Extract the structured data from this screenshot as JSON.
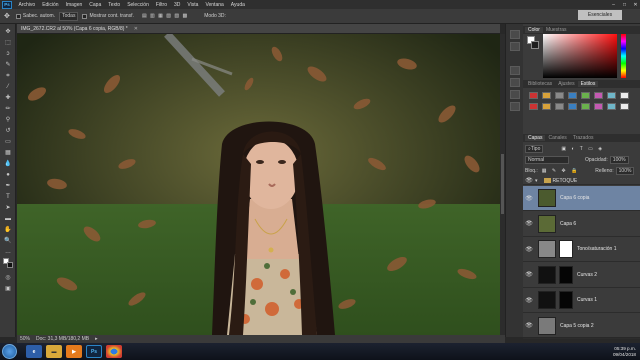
{
  "menu": {
    "items": [
      "Archivo",
      "Edición",
      "Imagen",
      "Capa",
      "Texto",
      "Selección",
      "Filtro",
      "3D",
      "Vista",
      "Ventana",
      "Ayuda"
    ]
  },
  "options": {
    "sample_label": "Todas",
    "align_label": "Sabec. autom.",
    "mode_label": "Muestrear todas las capas",
    "sample_field": "Mostrar cont. transf.",
    "mode3d": "Modo 3D:",
    "workspace": "Esenciales"
  },
  "document": {
    "tab_title": "IMG_2672.CR2 al 50% (Capa 6 copia, RGB/8) *",
    "zoom": "50%",
    "doc_info": "Doc: 31,3 MB/180,2 MB"
  },
  "panels": {
    "color_tabs": [
      "Color",
      "Muestras"
    ],
    "adjust_tabs": [
      "Bibliotecas",
      "Ajustes",
      "Estilos"
    ],
    "layers_tabs": [
      "Capas",
      "Canales",
      "Trazados"
    ],
    "kind_label": "Tipo",
    "blend_mode": "Normal",
    "opacity_label": "Opacidad:",
    "opacity_value": "100%",
    "lock_label": "Bloq.:",
    "fill_label": "Relleno:",
    "fill_value": "100%",
    "group_name": "RETOQUE",
    "layers": [
      {
        "name": "Capa 6 copia",
        "selected": true
      },
      {
        "name": "Capa 6",
        "selected": false
      },
      {
        "name": "Tono/saturación 1",
        "selected": false
      },
      {
        "name": "Curvas 2",
        "selected": false
      },
      {
        "name": "Curvas 1",
        "selected": false
      },
      {
        "name": "Capa 5 copia 2",
        "selected": false
      }
    ],
    "adj_icons": [
      "brightness-icon",
      "curves-icon",
      "levels-icon",
      "exposure-icon",
      "vibrance-icon",
      "hue-icon",
      "balance-icon",
      "bw-icon",
      "photo-filter-icon",
      "mixer-icon",
      "lookup-icon",
      "invert-icon",
      "posterize-icon",
      "threshold-icon",
      "gradient-map-icon",
      "selective-color-icon"
    ]
  },
  "taskbar": {
    "time": "05:39 p.m.",
    "date": "09/04/2018",
    "apps": [
      "ie-icon",
      "folder-icon",
      "media-icon",
      "photoshop-icon",
      "chrome-icon"
    ]
  },
  "colors": {
    "accent": "#6e84a3",
    "picker_hue": "#ff0f0f"
  }
}
